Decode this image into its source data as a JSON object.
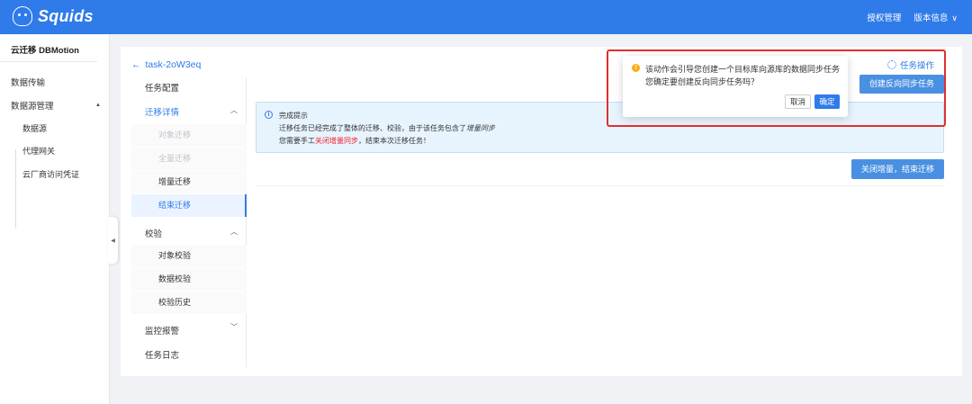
{
  "header": {
    "brand": "Squids",
    "links": [
      "授权管理",
      "版本信息"
    ]
  },
  "sidebar": {
    "title": "云迁移 DBMotion",
    "items": [
      "数据传输",
      "数据源管理"
    ],
    "subitems": [
      "数据源",
      "代理网关",
      "云厂商访问凭证"
    ]
  },
  "main": {
    "back_label": "task-2oW3eq",
    "task_ops_label": "任务操作",
    "reverse_sync_button": "创建反向同步任务",
    "close_increment_button": "关闭增量，结束迁移"
  },
  "inner_nav": {
    "config": "任务配置",
    "migration_group": "迁移详情",
    "migration_items": [
      "对象迁移",
      "全量迁移",
      "增量迁移",
      "结束迁移"
    ],
    "verify_group": "校验",
    "verify_items": [
      "对象校验",
      "数据校验",
      "校验历史"
    ],
    "monitor": "监控报警",
    "log": "任务日志"
  },
  "info": {
    "title": "完成提示",
    "line1_prefix": "迁移任务已经完成了整体的迁移、校验，由于该任务包含了",
    "line1_em": "增量同步",
    "line2_prefix": "您需要手工",
    "line2_red": "关闭增量同步",
    "line2_suffix": "，结束本次迁移任务！"
  },
  "popover": {
    "line1": "该动作会引导您创建一个目标库向源库的数据同步任务",
    "line2": "您确定要创建反向同步任务吗？",
    "cancel": "取消",
    "confirm": "确定"
  },
  "colors": {
    "primary": "#2f7bea",
    "warning": "#faad14",
    "danger": "#f5222d",
    "highlight": "#e0302d"
  }
}
